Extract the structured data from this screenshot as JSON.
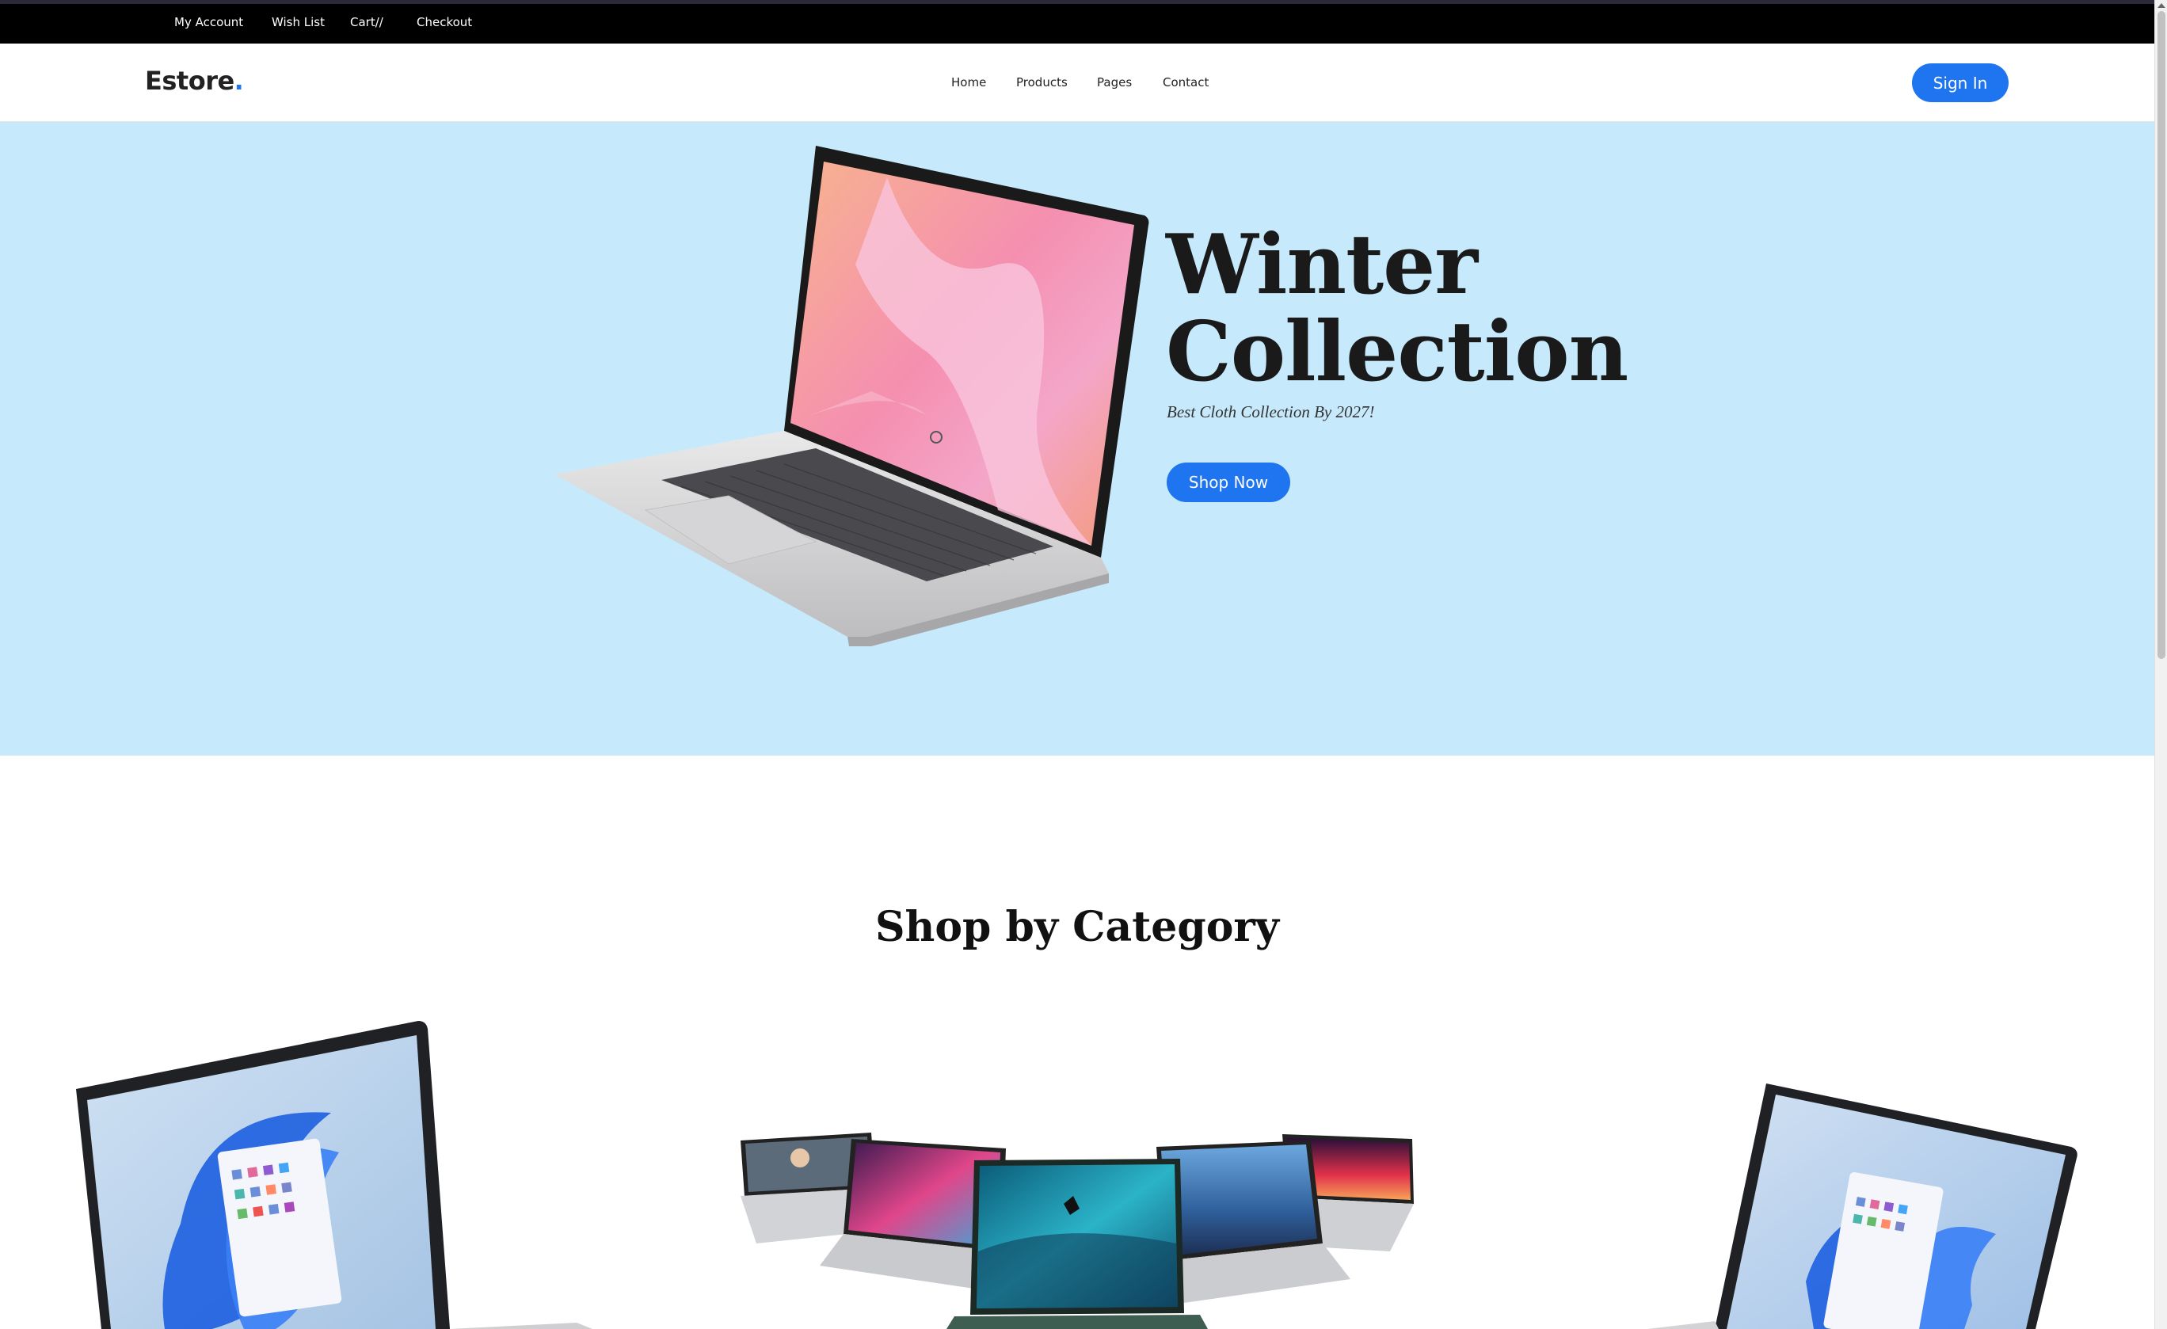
{
  "topbar": {
    "links": [
      "My Account",
      "Wish List",
      "Cart//",
      "Checkout"
    ]
  },
  "header": {
    "logo_text": "Estore",
    "logo_dot": ".",
    "nav": [
      "Home",
      "Products",
      "Pages",
      "Contact"
    ],
    "signin_label": "Sign In"
  },
  "hero": {
    "title_line1": "Winter",
    "title_line2": "Collection",
    "subtitle": "Best Cloth Collection By 2027!",
    "cta_label": "Shop Now"
  },
  "category": {
    "title": "Shop by Category"
  },
  "colors": {
    "accent": "#1f74f0",
    "hero_bg": "#c6eafc",
    "topbar_bg": "#000000"
  }
}
